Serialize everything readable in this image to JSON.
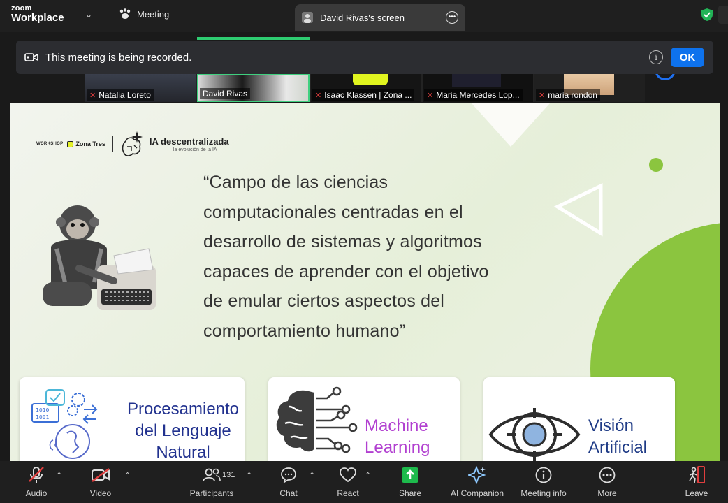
{
  "app": {
    "brand_top": "zoom",
    "brand_bottom": "Workplace"
  },
  "tabs": {
    "meeting": "Meeting",
    "screen": "David Rivas's screen"
  },
  "banner": {
    "message": "This meeting is being recorded.",
    "ok": "OK"
  },
  "participants_strip": [
    {
      "name": "Natalia Loreto",
      "muted": true
    },
    {
      "name": "David Rivas",
      "muted": false,
      "active": true
    },
    {
      "name": "Isaac Klassen | Zona ...",
      "muted": true
    },
    {
      "name": "Maria Mercedes Lop...",
      "muted": true
    },
    {
      "name": "maria rondon",
      "muted": true
    }
  ],
  "slide": {
    "logo_workshop": "WORKSHOP",
    "logo_zona": "Zona Tres",
    "logo_title": "IA descentralizada",
    "logo_subtitle": "la evolución de la IA",
    "quote_lines": [
      "“Campo de las ciencias",
      "computacionales centradas en el",
      "desarrollo de sistemas y algoritmos",
      "capaces de aprender con el objetivo",
      "de emular ciertos aspectos del",
      "comportamiento humano”"
    ],
    "cards": [
      {
        "title_lines": [
          "Procesamiento",
          "del Lenguaje",
          "Natural"
        ],
        "icon": "nlp-icon"
      },
      {
        "title_lines": [
          "Machine",
          "Learning"
        ],
        "icon": "brain-circuit-icon"
      },
      {
        "title_lines": [
          "Visión",
          "Artificial"
        ],
        "icon": "eye-target-icon"
      }
    ],
    "accent_color": "#8bc53f"
  },
  "toolbar": {
    "audio": "Audio",
    "video": "Video",
    "participants": "Participants",
    "participants_count": "131",
    "chat": "Chat",
    "react": "React",
    "share": "Share",
    "ai_companion": "AI Companion",
    "meeting_info": "Meeting info",
    "more": "More",
    "leave": "Leave"
  }
}
